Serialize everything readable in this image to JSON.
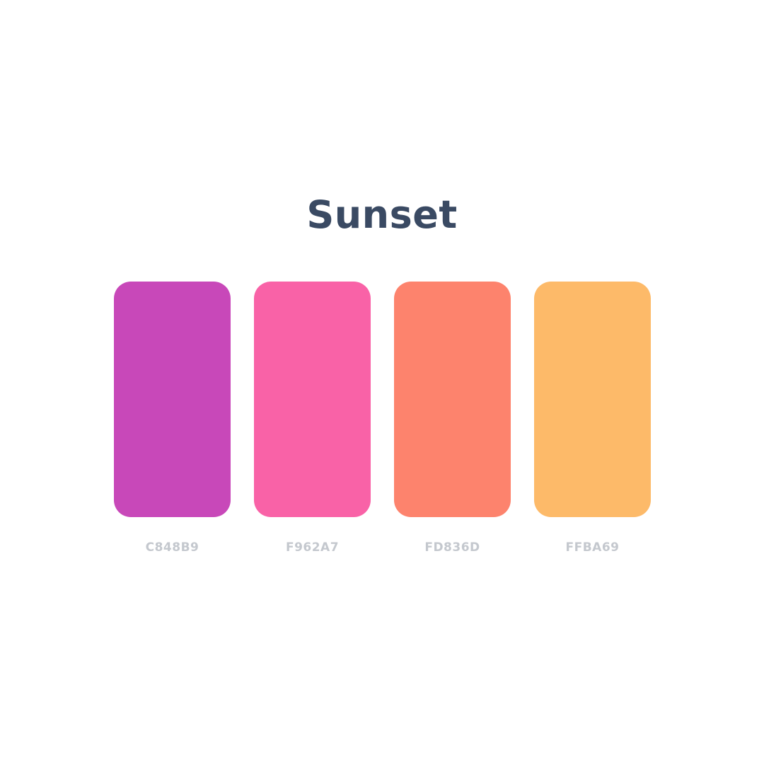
{
  "palette": {
    "title": "Sunset",
    "swatches": [
      {
        "hex": "C848B9",
        "color": "#c848b9"
      },
      {
        "hex": "F962A7",
        "color": "#f962a7"
      },
      {
        "hex": "FD836D",
        "color": "#fd836d"
      },
      {
        "hex": "FFBA69",
        "color": "#fdba69"
      }
    ],
    "colors": {
      "title": "#3a4a63",
      "hex_label": "#c4c8ce",
      "background": "#ffffff"
    }
  }
}
